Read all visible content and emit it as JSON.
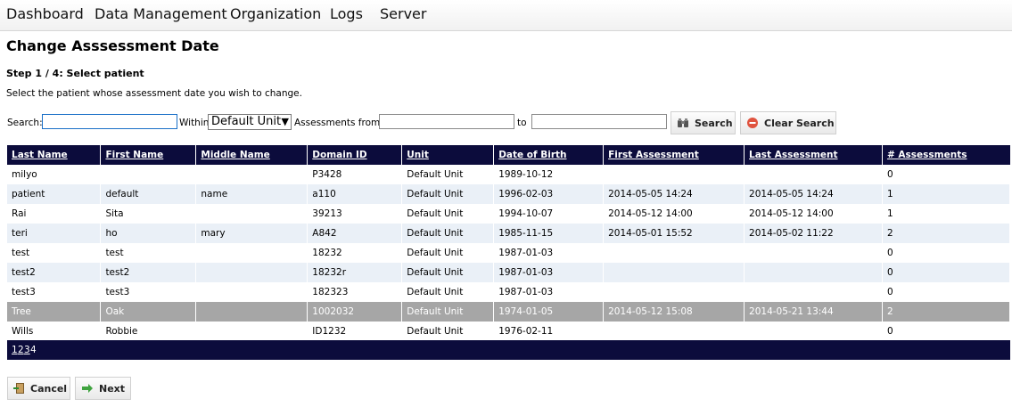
{
  "nav": [
    "Dashboard",
    "Data Management",
    "Organization",
    "Logs",
    "Server"
  ],
  "page_title": "Change Asssessment Date",
  "step": "Step 1 / 4: Select patient",
  "instructions": "Select the patient whose assessment date you wish to change.",
  "search": {
    "label": "Search:",
    "value": "",
    "within_label": "Within",
    "unit_selected": "Default Unit",
    "assessments_from_label": "Assessments from",
    "from_value": "",
    "to_label": "to",
    "to_value": "",
    "search_button": "Search",
    "clear_button": "Clear Search"
  },
  "table": {
    "columns": [
      "Last Name",
      "First Name",
      "Middle Name",
      "Domain ID",
      "Unit",
      "Date of Birth",
      "First Assessment",
      "Last Assessment",
      "# Assessments"
    ],
    "rows": [
      [
        "milyo",
        "",
        "",
        "P3428",
        "Default Unit",
        "1989-10-12",
        "",
        "",
        "0"
      ],
      [
        "patient",
        "default",
        "name",
        "a110",
        "Default Unit",
        "1996-02-03",
        "2014-05-05 14:24",
        "2014-05-05 14:24",
        "1"
      ],
      [
        "Rai",
        "Sita",
        "",
        "39213",
        "Default Unit",
        "1994-10-07",
        "2014-05-12 14:00",
        "2014-05-12 14:00",
        "1"
      ],
      [
        "teri",
        "ho",
        "mary",
        "A842",
        "Default Unit",
        "1985-11-15",
        "2014-05-01 15:52",
        "2014-05-02 11:22",
        "2"
      ],
      [
        "test",
        "test",
        "",
        "18232",
        "Default Unit",
        "1987-01-03",
        "",
        "",
        "0"
      ],
      [
        "test2",
        "test2",
        "",
        "18232r",
        "Default Unit",
        "1987-01-03",
        "",
        "",
        "0"
      ],
      [
        "test3",
        "test3",
        "",
        "182323",
        "Default Unit",
        "1987-01-03",
        "",
        "",
        "0"
      ],
      [
        "Tree",
        "Oak",
        "",
        "1002032",
        "Default Unit",
        "1974-01-05",
        "2014-05-12 15:08",
        "2014-05-21 13:44",
        "2"
      ],
      [
        "Wills",
        "Robbie",
        "",
        "ID1232",
        "Default Unit",
        "1976-02-11",
        "",
        "",
        "0"
      ]
    ],
    "selected_row": 7
  },
  "pager": {
    "pages": [
      "1",
      "2",
      "3",
      "4"
    ],
    "current": "4"
  },
  "buttons": {
    "cancel": "Cancel",
    "next": "Next"
  },
  "icons": {
    "search": "binoculars-icon",
    "clear": "clear-circle-icon",
    "cancel": "exit-door-icon",
    "next": "arrow-right-icon"
  }
}
